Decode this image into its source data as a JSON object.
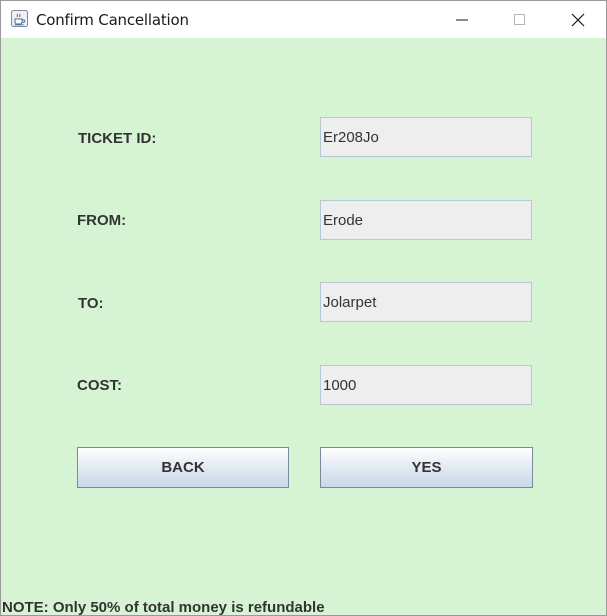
{
  "window": {
    "title": "Confirm Cancellation",
    "icon": "java-cup-icon",
    "controls": [
      "minimize-icon",
      "maximize-icon",
      "close-icon"
    ]
  },
  "form": {
    "ticket_id": {
      "label": "TICKET ID:",
      "value": "Er208Jo"
    },
    "from": {
      "label": "FROM:",
      "value": "Erode"
    },
    "to": {
      "label": "TO:",
      "value": "Jolarpet"
    },
    "cost": {
      "label": "COST:",
      "value": "1000"
    }
  },
  "buttons": {
    "back": "BACK",
    "yes": "YES"
  },
  "note": "NOTE: Only 50% of total money is refundable",
  "colors": {
    "background": "#d6f4d4",
    "field_background": "#eeeeee",
    "text": "#333333"
  }
}
